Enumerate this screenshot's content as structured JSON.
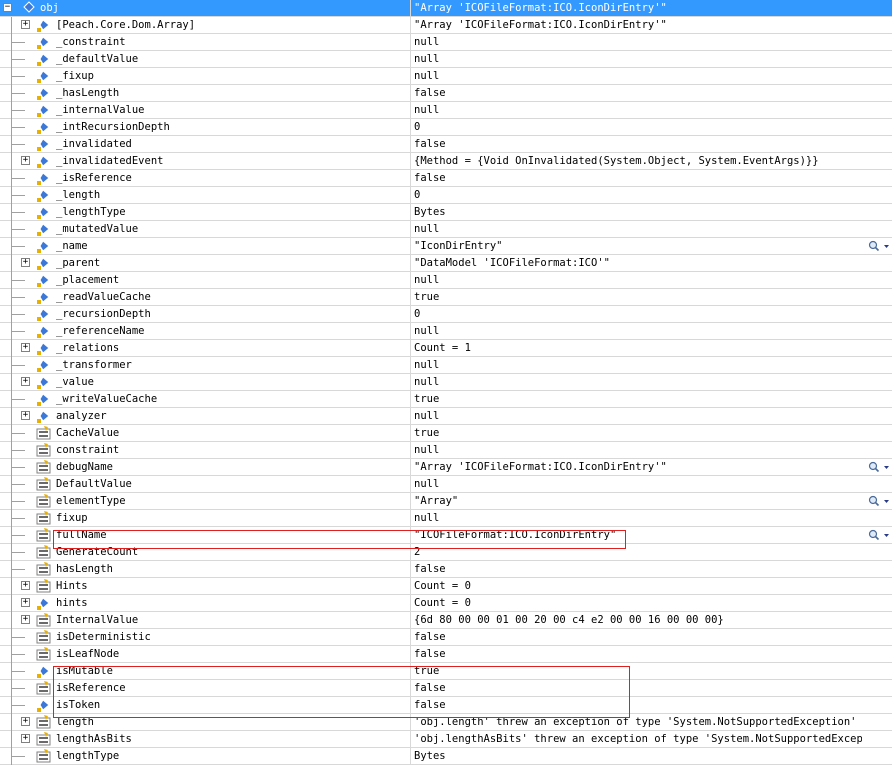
{
  "watch": {
    "root": {
      "name": "obj",
      "value": "\"Array 'ICOFileFormat:ICO.IconDirEntry'\"",
      "icon": "field-icon",
      "expander": "minus"
    },
    "rows": [
      {
        "name": "[Peach.Core.Dom.Array]",
        "value": "\"Array 'ICOFileFormat:ICO.IconDirEntry'\"",
        "icon": "field-icon",
        "expander": "plus"
      },
      {
        "name": "_constraint",
        "value": "null",
        "icon": "field-icon"
      },
      {
        "name": "_defaultValue",
        "value": "null",
        "icon": "field-icon"
      },
      {
        "name": "_fixup",
        "value": "null",
        "icon": "field-icon"
      },
      {
        "name": "_hasLength",
        "value": "false",
        "icon": "field-icon"
      },
      {
        "name": "_internalValue",
        "value": "null",
        "icon": "field-icon"
      },
      {
        "name": "_intRecursionDepth",
        "value": "0",
        "icon": "field-icon"
      },
      {
        "name": "_invalidated",
        "value": "false",
        "icon": "field-icon"
      },
      {
        "name": "_invalidatedEvent",
        "value": "{Method = {Void OnInvalidated(System.Object, System.EventArgs)}}",
        "icon": "field-icon",
        "expander": "plus"
      },
      {
        "name": "_isReference",
        "value": "false",
        "icon": "field-icon"
      },
      {
        "name": "_length",
        "value": "0",
        "icon": "field-icon"
      },
      {
        "name": "_lengthType",
        "value": "Bytes",
        "icon": "field-icon"
      },
      {
        "name": "_mutatedValue",
        "value": "null",
        "icon": "field-icon"
      },
      {
        "name": "_name",
        "value": "\"IconDirEntry\"",
        "icon": "field-icon",
        "magnifier": true
      },
      {
        "name": "_parent",
        "value": "\"DataModel 'ICOFileFormat:ICO'\"",
        "icon": "field-icon",
        "expander": "plus"
      },
      {
        "name": "_placement",
        "value": "null",
        "icon": "field-icon"
      },
      {
        "name": "_readValueCache",
        "value": "true",
        "icon": "field-icon"
      },
      {
        "name": "_recursionDepth",
        "value": "0",
        "icon": "field-icon"
      },
      {
        "name": "_referenceName",
        "value": "null",
        "icon": "field-icon"
      },
      {
        "name": "_relations",
        "value": "Count = 1",
        "icon": "field-icon",
        "expander": "plus"
      },
      {
        "name": "_transformer",
        "value": "null",
        "icon": "field-icon"
      },
      {
        "name": "_value",
        "value": "null",
        "icon": "field-icon",
        "expander": "plus"
      },
      {
        "name": "_writeValueCache",
        "value": "true",
        "icon": "field-icon"
      },
      {
        "name": "analyzer",
        "value": "null",
        "icon": "field-icon",
        "expander": "plus"
      },
      {
        "name": "CacheValue",
        "value": "true",
        "icon": "property-icon"
      },
      {
        "name": "constraint",
        "value": "null",
        "icon": "property-icon"
      },
      {
        "name": "debugName",
        "value": "\"Array 'ICOFileFormat:ICO.IconDirEntry'\"",
        "icon": "property-icon",
        "magnifier": true
      },
      {
        "name": "DefaultValue",
        "value": "null",
        "icon": "property-icon"
      },
      {
        "name": "elementType",
        "value": "\"Array\"",
        "icon": "property-icon",
        "magnifier": true
      },
      {
        "name": "fixup",
        "value": "null",
        "icon": "property-icon"
      },
      {
        "name": "fullName",
        "value": "\"ICOFileFormat:ICO.IconDirEntry\"",
        "icon": "property-icon",
        "magnifier": true
      },
      {
        "name": "GenerateCount",
        "value": "2",
        "icon": "property-icon"
      },
      {
        "name": "hasLength",
        "value": "false",
        "icon": "property-icon"
      },
      {
        "name": "Hints",
        "value": "Count = 0",
        "icon": "property-icon",
        "expander": "plus"
      },
      {
        "name": "hints",
        "value": "Count = 0",
        "icon": "field-icon",
        "expander": "plus"
      },
      {
        "name": "InternalValue",
        "value": "{6d 80 00 00 01 00 20 00 c4 e2 00 00 16 00 00 00}",
        "icon": "property-icon",
        "expander": "plus"
      },
      {
        "name": "isDeterministic",
        "value": "false",
        "icon": "property-icon"
      },
      {
        "name": "isLeafNode",
        "value": "false",
        "icon": "property-icon"
      },
      {
        "name": "isMutable",
        "value": "true",
        "icon": "field-icon"
      },
      {
        "name": "isReference",
        "value": "false",
        "icon": "property-icon"
      },
      {
        "name": "isToken",
        "value": "false",
        "icon": "field-icon"
      },
      {
        "name": "length",
        "value": "'obj.length' threw an exception of type 'System.NotSupportedException'",
        "icon": "property-icon",
        "expander": "plus"
      },
      {
        "name": "lengthAsBits",
        "value": "'obj.lengthAsBits' threw an exception of type 'System.NotSupportedException'",
        "icon": "property-icon",
        "expander": "plus"
      },
      {
        "name": "lengthType",
        "value": "Bytes",
        "icon": "property-icon"
      }
    ]
  },
  "colors": {
    "selection": "#3399ff",
    "grid_line": "#d8d8d8",
    "highlight_box": "#e02020"
  }
}
